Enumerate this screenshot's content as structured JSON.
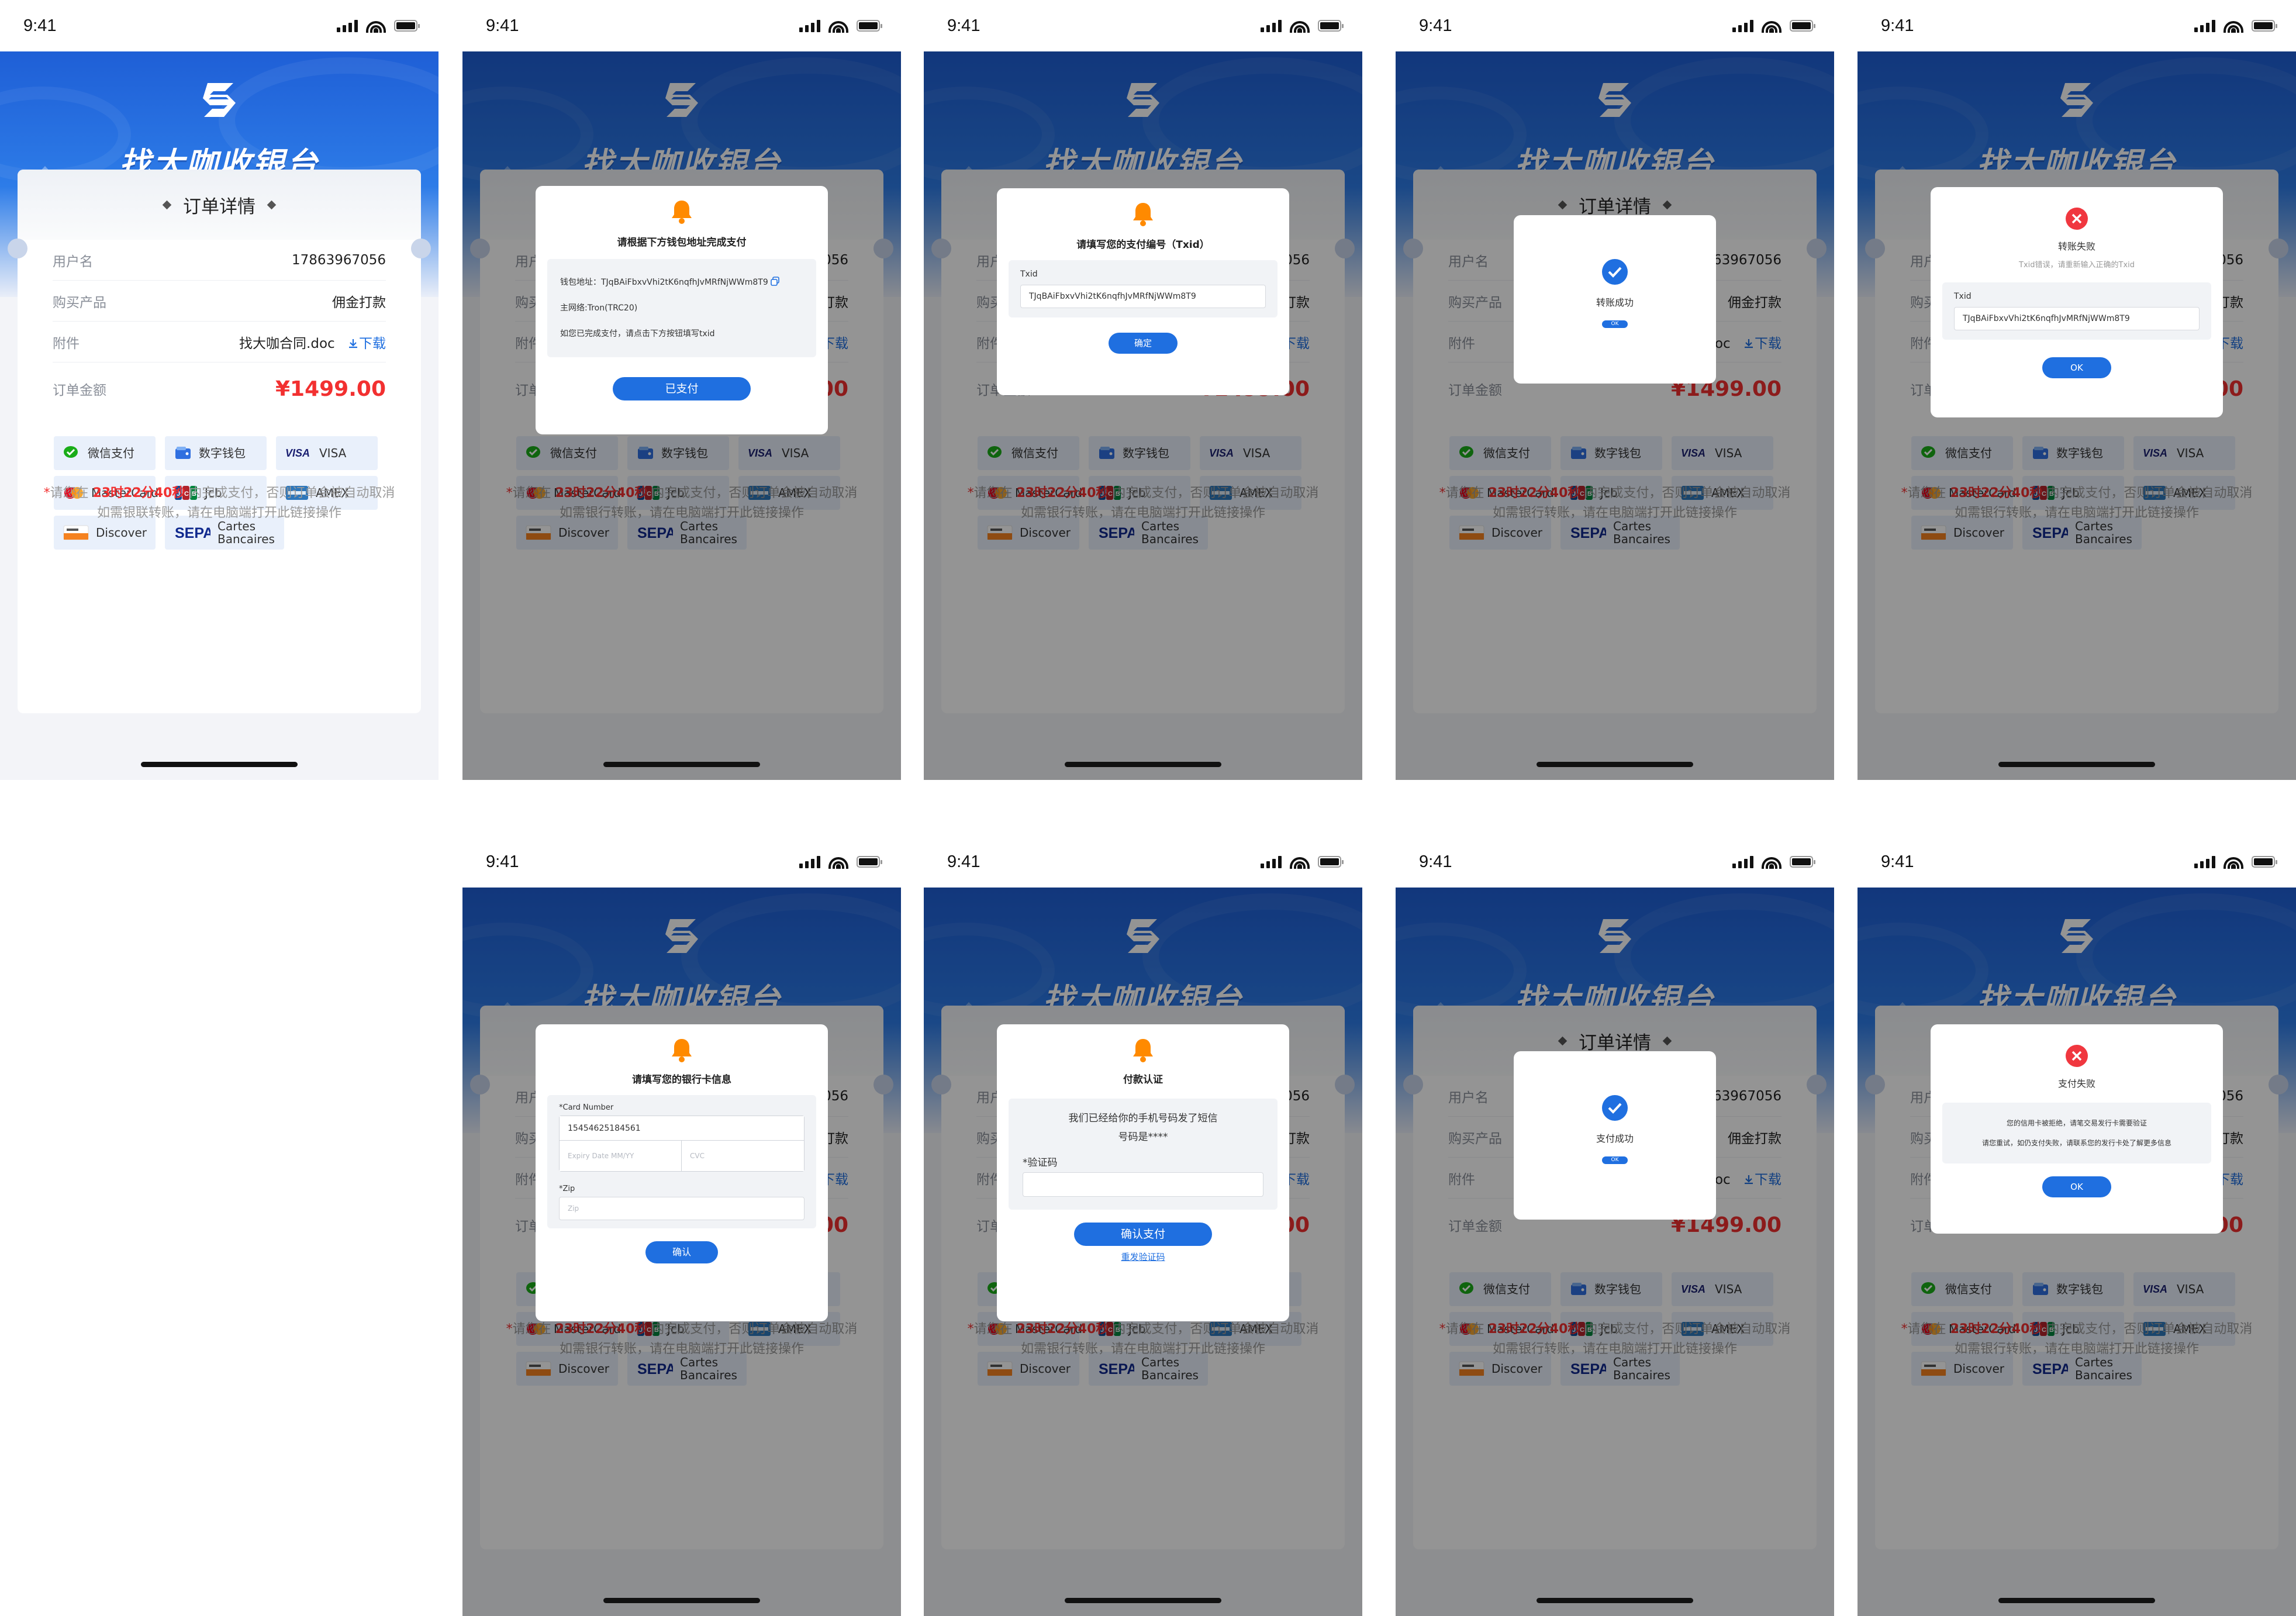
{
  "status_bar": {
    "time": "9:41"
  },
  "header": {
    "brand": "找大咖收银台"
  },
  "order": {
    "title": "订单详情",
    "username_label": "用户名",
    "username": "17863967056",
    "product_label": "购买产品",
    "product": "佣金打款",
    "attachment_label": "附件",
    "attachment": "找大咖合同.doc",
    "download": "下载",
    "amount_label": "订单金额",
    "amount": "¥1499.00"
  },
  "payment_methods": [
    {
      "icon": "wechat-pay-icon",
      "label": "微信支付",
      "color": "#1aad19"
    },
    {
      "icon": "digital-wallet-icon",
      "label": "数字钱包",
      "color": "#2f6fe0"
    },
    {
      "icon": "visa-icon",
      "label": "VISA",
      "color": "#1a1f71"
    },
    {
      "icon": "mastercard-icon",
      "label": "MasterCard",
      "color": "#eb001b"
    },
    {
      "icon": "jcb-icon",
      "label": "Jcb",
      "color": "#0e4c96"
    },
    {
      "icon": "amex-icon",
      "label": "AMEX",
      "color": "#2e77bb"
    },
    {
      "icon": "discover-icon",
      "label": "Discover",
      "color": "#f58220"
    },
    {
      "icon": "sepa-icon",
      "label": "Cartes Bancaires",
      "color": "#10298e"
    }
  ],
  "notice": {
    "prefix": "*",
    "before": "请您在 ",
    "time": "23时22分40秒",
    "after": " 内完成支付，否则订单会被自动取消",
    "line2": "如需银联转账，请在电脑端打开此链接操作",
    "line2_alt": "如需银行转账，请在电脑端打开此链接操作"
  },
  "modals": {
    "wallet": {
      "title": "请根据下方钱包地址完成支付",
      "address_label": "钱包地址：",
      "address": "TJqBAiFbxvVhi2tK6nqfhJvMRfNjWWm8T9",
      "network_label": "主网络:",
      "network": "Tron(TRC20)",
      "hint": "如您已完成支付，请点击下方按钮填写txid",
      "button": "已支付"
    },
    "txid": {
      "title": "请填写您的支付编号（Txid）",
      "field_label": "Txid",
      "value": "TJqBAiFbxvVhi2tK6nqfhJvMRfNjWWm8T9",
      "button": "确定"
    },
    "transfer_success": {
      "title": "转账成功",
      "button": "OK"
    },
    "transfer_fail": {
      "title": "转账失败",
      "subtitle": "Txid错误，请重新输入正确的Txid",
      "field_label": "Txid",
      "value": "TJqBAiFbxvVhi2tK6nqfhJvMRfNjWWm8T9",
      "button": "OK"
    },
    "bank_card": {
      "title": "请填写您的银行卡信息",
      "card_label": "*Card Number",
      "card_value": "15454625184561",
      "expiry_placeholder": "Expiry Date MM/YY",
      "cvc_placeholder": "CVC",
      "zip_label": "*Zip",
      "zip_placeholder": "Zip",
      "button": "确认"
    },
    "sms": {
      "title": "付款认证",
      "message_line1": "我们已经给你的手机号码发了短信",
      "message_line2": "号码是****",
      "code_label": "*验证码",
      "button": "确认支付",
      "resend": "重发验证码"
    },
    "pay_success": {
      "title": "支付成功",
      "button": "OK"
    },
    "pay_fail": {
      "title": "支付失败",
      "line1": "您的信用卡被拒绝，请笔交易发行卡需要验证",
      "line2": "请您重试，如仍支付失败，请联系您的发行卡处了解更多信息",
      "button": "OK"
    }
  }
}
